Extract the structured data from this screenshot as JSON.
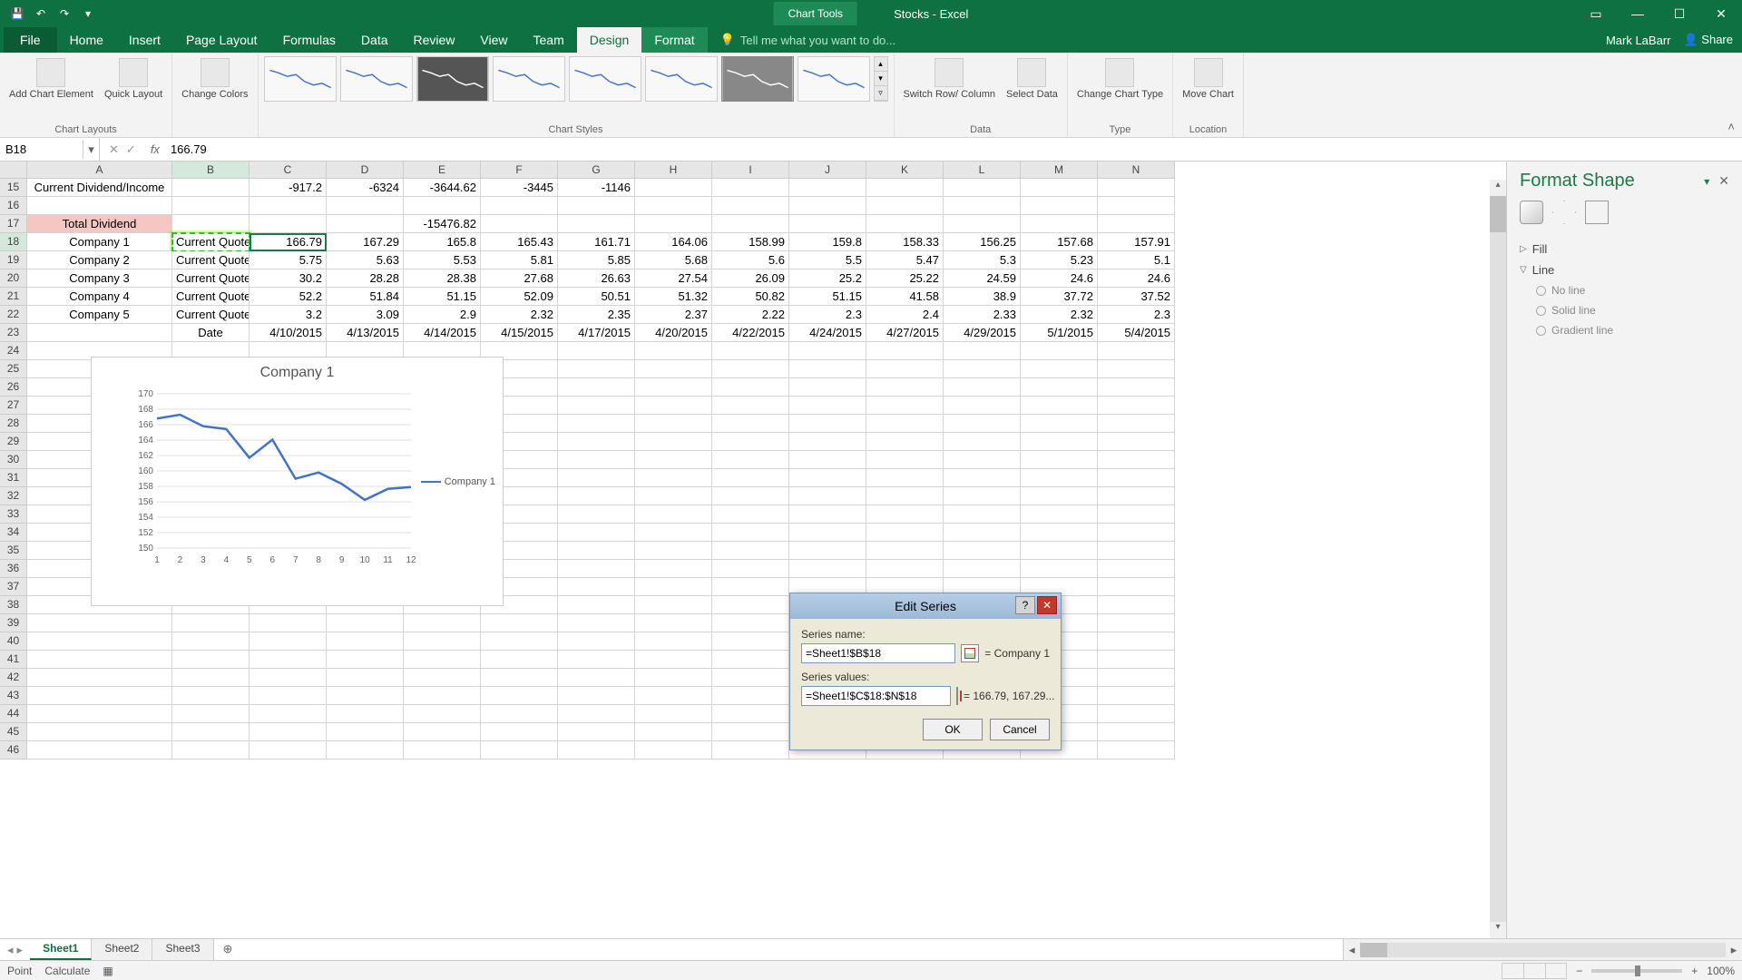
{
  "app": {
    "doc_title": "Stocks - Excel",
    "chart_tools": "Chart Tools",
    "user": "Mark LaBarr",
    "share": "Share"
  },
  "tabs": {
    "file": "File",
    "list": [
      "Home",
      "Insert",
      "Page Layout",
      "Formulas",
      "Data",
      "Review",
      "View",
      "Team"
    ],
    "ctx": [
      "Design",
      "Format"
    ],
    "active": "Design",
    "tellme": "Tell me what you want to do..."
  },
  "ribbon": {
    "chart_layouts": {
      "add_element": "Add Chart Element",
      "quick_layout": "Quick Layout",
      "label": "Chart Layouts"
    },
    "change_colors": "Change Colors",
    "chart_styles": "Chart Styles",
    "data": {
      "switch": "Switch Row/ Column",
      "select": "Select Data",
      "label": "Data"
    },
    "type": {
      "change": "Change Chart Type",
      "label": "Type"
    },
    "location": {
      "move": "Move Chart",
      "label": "Location"
    }
  },
  "formula_bar": {
    "name_box": "B18",
    "fx": "fx",
    "value": "166.79"
  },
  "columns": [
    "A",
    "B",
    "C",
    "D",
    "E",
    "F",
    "G",
    "H",
    "I",
    "J",
    "K",
    "L",
    "M",
    "N"
  ],
  "rows_visible": [
    15,
    16,
    17,
    18,
    19,
    20,
    21,
    22,
    23,
    24,
    25,
    26,
    27,
    28,
    29,
    30,
    31,
    32,
    33,
    34,
    35,
    36,
    37,
    38,
    39,
    40,
    41,
    42,
    43,
    44,
    45,
    46
  ],
  "table": {
    "r15": {
      "A": "Current Dividend/Income",
      "C": "-917.2",
      "D": "-6324",
      "E": "-3644.62",
      "F": "-3445",
      "G": "-1146"
    },
    "r17": {
      "A": "Total Dividend",
      "E": "-15476.82"
    },
    "r18": {
      "A": "Company 1",
      "B": "Current Quote",
      "C": "166.79",
      "D": "167.29",
      "E": "165.8",
      "F": "165.43",
      "G": "161.71",
      "H": "164.06",
      "I": "158.99",
      "J": "159.8",
      "K": "158.33",
      "L": "156.25",
      "M": "157.68",
      "N": "157.91"
    },
    "r19": {
      "A": "Company 2",
      "B": "Current Quote",
      "C": "5.75",
      "D": "5.63",
      "E": "5.53",
      "F": "5.81",
      "G": "5.85",
      "H": "5.68",
      "I": "5.6",
      "J": "5.5",
      "K": "5.47",
      "L": "5.3",
      "M": "5.23",
      "N": "5.1"
    },
    "r20": {
      "A": "Company 3",
      "B": "Current Quote",
      "C": "30.2",
      "D": "28.28",
      "E": "28.38",
      "F": "27.68",
      "G": "26.63",
      "H": "27.54",
      "I": "26.09",
      "J": "25.2",
      "K": "25.22",
      "L": "24.59",
      "M": "24.6",
      "N": "24.6"
    },
    "r21": {
      "A": "Company 4",
      "B": "Current Quote",
      "C": "52.2",
      "D": "51.84",
      "E": "51.15",
      "F": "52.09",
      "G": "50.51",
      "H": "51.32",
      "I": "50.82",
      "J": "51.15",
      "K": "41.58",
      "L": "38.9",
      "M": "37.72",
      "N": "37.52"
    },
    "r22": {
      "A": "Company 5",
      "B": "Current Quote",
      "C": "3.2",
      "D": "3.09",
      "E": "2.9",
      "F": "2.32",
      "G": "2.35",
      "H": "2.37",
      "I": "2.22",
      "J": "2.3",
      "K": "2.4",
      "L": "2.33",
      "M": "2.32",
      "N": "2.3"
    },
    "r23": {
      "B": "Date",
      "C": "4/10/2015",
      "D": "4/13/2015",
      "E": "4/14/2015",
      "F": "4/15/2015",
      "G": "4/17/2015",
      "H": "4/20/2015",
      "I": "4/22/2015",
      "J": "4/24/2015",
      "K": "4/27/2015",
      "L": "4/29/2015",
      "M": "5/1/2015",
      "N": "5/4/2015"
    }
  },
  "chart_data": {
    "type": "line",
    "title": "Company 1",
    "x": [
      1,
      2,
      3,
      4,
      5,
      6,
      7,
      8,
      9,
      10,
      11,
      12
    ],
    "series": [
      {
        "name": "Company 1",
        "values": [
          166.79,
          167.29,
          165.8,
          165.43,
          161.71,
          164.06,
          158.99,
          159.8,
          158.33,
          156.25,
          157.68,
          157.91
        ]
      }
    ],
    "ylim": [
      150,
      170
    ],
    "y_ticks": [
      150,
      152,
      154,
      156,
      158,
      160,
      162,
      164,
      166,
      168,
      170
    ],
    "legend": "Company 1"
  },
  "dialog": {
    "title": "Edit Series",
    "series_name_label": "Series name:",
    "series_name_value": "=Sheet1!$B$18",
    "series_name_result": "= Company 1",
    "series_values_label": "Series values:",
    "series_values_value": "=Sheet1!$C$18:$N$18",
    "series_values_result": "= 166.79, 167.29...",
    "ok": "OK",
    "cancel": "Cancel"
  },
  "pane": {
    "title": "Format Shape",
    "fill": "Fill",
    "line": "Line",
    "no_line": "No line",
    "solid_line": "Solid line",
    "gradient_line": "Gradient line"
  },
  "sheets": {
    "tabs": [
      "Sheet1",
      "Sheet2",
      "Sheet3"
    ],
    "active": "Sheet1"
  },
  "status": {
    "mode": "Point",
    "calc": "Calculate",
    "zoom": "100%"
  }
}
